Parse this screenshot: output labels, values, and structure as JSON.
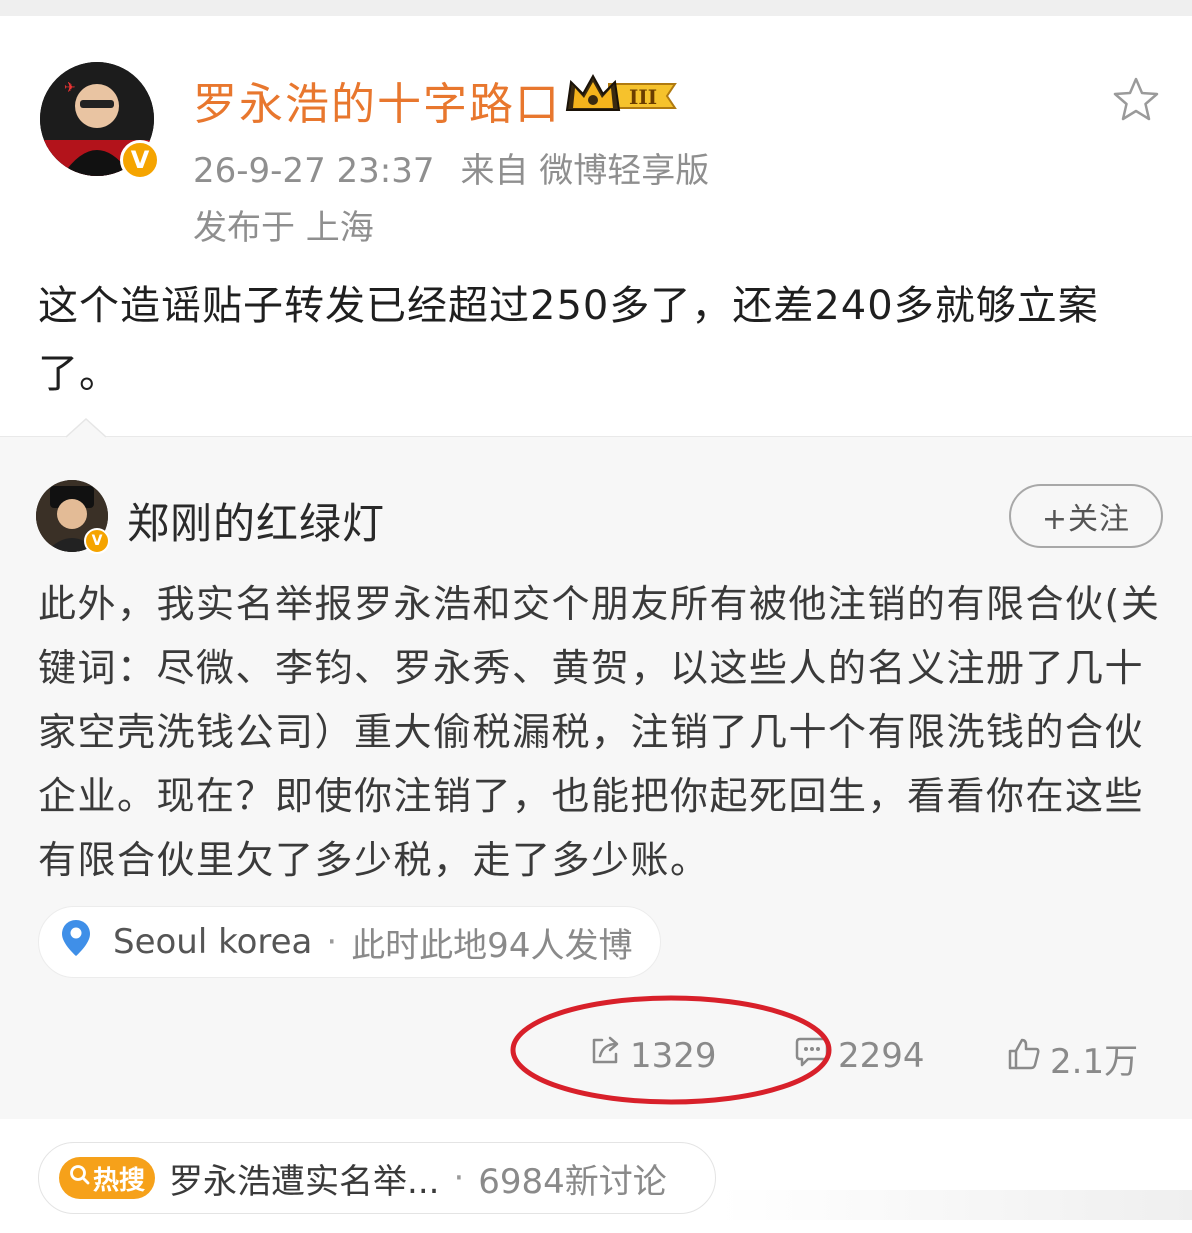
{
  "post": {
    "author_name": "罗永浩的十字路口",
    "level_badge": "III",
    "time": "26-9-27 23:37",
    "source": "来自 微博轻享版",
    "location": "发布于 上海",
    "text": "这个造谣贴子转发已经超过250多了，还差240多就够立案了。",
    "verified_mark": "V",
    "avatar_caption": "罗永浩的十字路口"
  },
  "repost": {
    "author_name": "郑刚的红绿灯",
    "follow_label": "+关注",
    "verified_mark": "V",
    "text": "此外，我实名举报罗永浩和交个朋友所有被他注销的有限合伙(关键词：尽微、李钧、罗永秀、黄贺，以这些人的名义注册了几十家空壳洗钱公司）重大偷税漏税，注销了几十个有限洗钱的合伙企业。现在？即使你注销了，也能把你起死回生，看看你在这些有限合伙里欠了多少税，走了多少账。",
    "location_chip": {
      "place": "Seoul korea",
      "separator": "·",
      "detail": "此时此地94人发博"
    },
    "actions": {
      "reposts": "1329",
      "comments": "2294",
      "likes": "2.1万"
    }
  },
  "hot_search": {
    "tag": "热搜",
    "topic": "罗永浩遭实名举...",
    "separator": "·",
    "count": "6984新讨论"
  },
  "colors": {
    "author_name": "#e8772e",
    "meta": "#8f8f8f",
    "card_bg": "#f7f7f7",
    "annotation_ellipse": "#d8202a",
    "hot_tag": "#f6a11a",
    "location_pin": "#3f8fe8"
  },
  "icons": {
    "favorite": "star-icon",
    "repost": "repost-icon",
    "comment": "comment-icon",
    "like": "thumbs-up-icon",
    "location": "location-pin-icon",
    "search": "search-icon"
  }
}
